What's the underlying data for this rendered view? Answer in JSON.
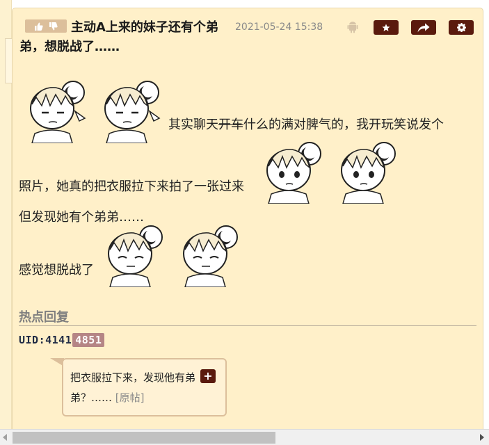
{
  "post": {
    "title": "主动A上来的妹子还有个弟弟，想脱战了……",
    "date": "2021-05-24 15:38",
    "icons": {
      "thumbs_up": "thumbs-up-icon",
      "thumbs_down": "thumbs-down-icon",
      "platform": "android-icon",
      "favorite": "star-icon",
      "share": "share-icon",
      "settings": "gear-icon"
    },
    "body": {
      "line1_pre": "其实聊天",
      "line1_strike": "开车",
      "line1_post": "什么的满对脾气的，我开玩笑说发个",
      "line2": "照片，她真的把衣服拉下来拍了一张过来",
      "line3": "但发现她有个弟弟……",
      "line4": "感觉想脱战了"
    }
  },
  "hot_replies": {
    "heading": "热点回复",
    "uid_prefix": "UID:4141",
    "uid_highlight": "4851",
    "reply_text": "把衣服拉下来，发现他有弟弟？……",
    "reply_link": "[原帖]",
    "plus_label": "+"
  },
  "colors": {
    "panel_bg": "#fff0c9",
    "button_brown": "#5a1a0d",
    "vote_tan": "#dcbf9b",
    "uid_tag": "#b58585"
  }
}
